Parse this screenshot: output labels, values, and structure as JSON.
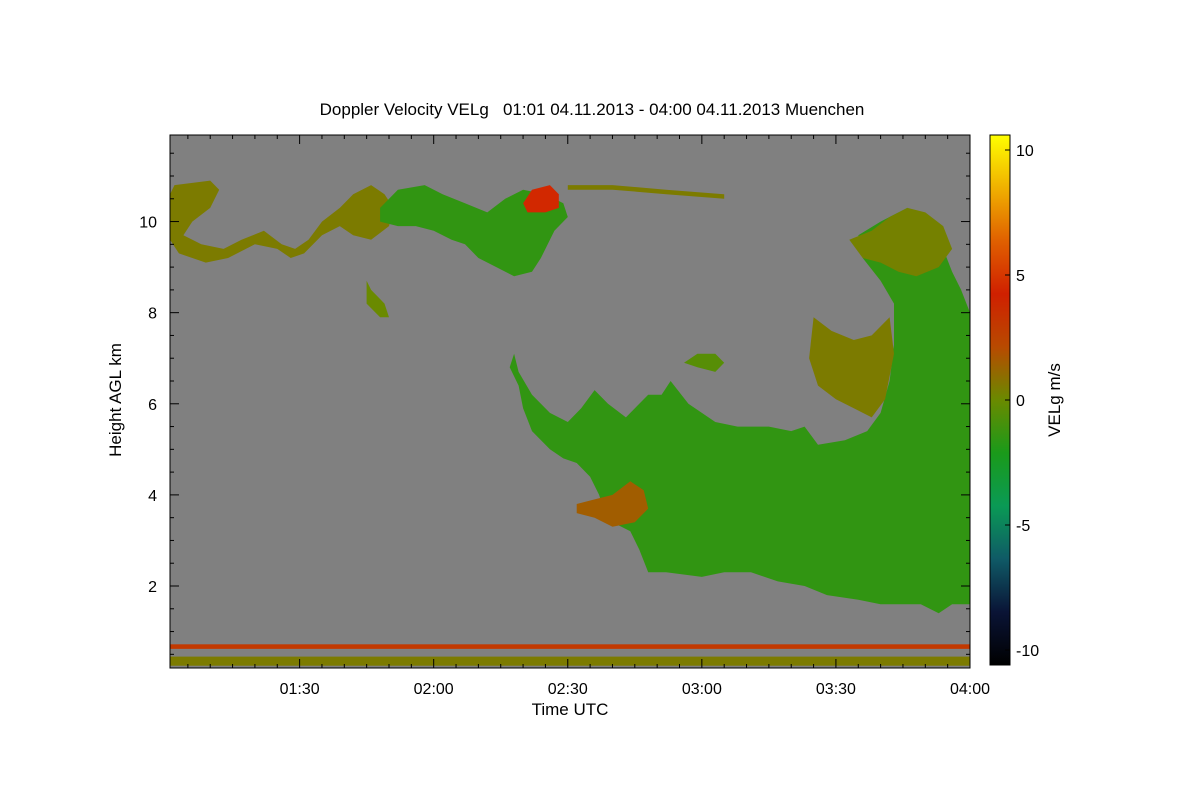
{
  "chart_data": {
    "type": "heatmap",
    "title": "Doppler Velocity VELg   01:01 04.11.2013 - 04:00 04.11.2013 Muenchen",
    "xlabel": "Time UTC",
    "ylabel": "Height AGL km",
    "x_tick_labels": [
      "01:30",
      "02:00",
      "02:30",
      "03:00",
      "03:30",
      "04:00"
    ],
    "x_tick_values_min": [
      90,
      120,
      150,
      180,
      210,
      240
    ],
    "xlim_min": [
      61,
      240
    ],
    "y_ticks": [
      2,
      4,
      6,
      8,
      10
    ],
    "ylim": [
      0.2,
      11.9
    ],
    "colorbar": {
      "label": "VELg m/s",
      "ticks": [
        10,
        5,
        0,
        -5,
        -10
      ],
      "range": [
        -10.6,
        10.6
      ],
      "colors": [
        "#000000",
        "#0a1436",
        "#0f5a66",
        "#0a9a55",
        "#1a9a1a",
        "#6a8a00",
        "#b84a00",
        "#d02000",
        "#e06000",
        "#f0b000",
        "#ffff00"
      ]
    },
    "background_color": "#808080",
    "echo_regions": [
      {
        "name": "upper-cloud-band-west",
        "mean_velocity": 0.5,
        "poly": [
          [
            61,
            10.6
          ],
          [
            62,
            10.8
          ],
          [
            70,
            10.9
          ],
          [
            72,
            10.7
          ],
          [
            70,
            10.3
          ],
          [
            66,
            10.0
          ],
          [
            64,
            9.7
          ],
          [
            68,
            9.5
          ],
          [
            73,
            9.4
          ],
          [
            77,
            9.6
          ],
          [
            82,
            9.8
          ],
          [
            86,
            9.5
          ],
          [
            89,
            9.4
          ],
          [
            92,
            9.6
          ],
          [
            95,
            10.0
          ],
          [
            99,
            10.3
          ],
          [
            102,
            10.6
          ],
          [
            106,
            10.8
          ],
          [
            109,
            10.6
          ],
          [
            111,
            10.3
          ],
          [
            110,
            9.9
          ],
          [
            106,
            9.6
          ],
          [
            102,
            9.7
          ],
          [
            99,
            9.9
          ],
          [
            95,
            9.7
          ],
          [
            91,
            9.3
          ],
          [
            88,
            9.2
          ],
          [
            85,
            9.4
          ],
          [
            80,
            9.5
          ],
          [
            74,
            9.2
          ],
          [
            69,
            9.1
          ],
          [
            63,
            9.3
          ],
          [
            61,
            9.6
          ]
        ]
      },
      {
        "name": "upper-cloud-band-center",
        "mean_velocity": -1.5,
        "poly": [
          [
            108,
            10.3
          ],
          [
            112,
            10.7
          ],
          [
            118,
            10.8
          ],
          [
            122,
            10.6
          ],
          [
            127,
            10.4
          ],
          [
            132,
            10.2
          ],
          [
            136,
            10.5
          ],
          [
            140,
            10.7
          ],
          [
            145,
            10.6
          ],
          [
            149,
            10.4
          ],
          [
            150,
            10.1
          ],
          [
            147,
            9.8
          ],
          [
            144,
            9.2
          ],
          [
            142,
            8.9
          ],
          [
            138,
            8.8
          ],
          [
            134,
            9.0
          ],
          [
            130,
            9.2
          ],
          [
            127,
            9.5
          ],
          [
            124,
            9.6
          ],
          [
            120,
            9.8
          ],
          [
            116,
            9.9
          ],
          [
            112,
            9.9
          ],
          [
            108,
            10.0
          ]
        ]
      },
      {
        "name": "warm-blob-top",
        "mean_velocity": 4.5,
        "poly": [
          [
            140,
            10.4
          ],
          [
            142,
            10.7
          ],
          [
            146,
            10.8
          ],
          [
            148,
            10.6
          ],
          [
            148,
            10.3
          ],
          [
            145,
            10.2
          ],
          [
            141,
            10.2
          ]
        ]
      },
      {
        "name": "small-cell-8km",
        "mean_velocity": 0.0,
        "poly": [
          [
            105,
            8.7
          ],
          [
            106,
            8.5
          ],
          [
            109,
            8.2
          ],
          [
            110,
            7.9
          ],
          [
            108,
            7.9
          ],
          [
            105,
            8.2
          ]
        ]
      },
      {
        "name": "thin-filament-10.8km",
        "mean_velocity": 0.5,
        "poly": [
          [
            150,
            10.8
          ],
          [
            160,
            10.8
          ],
          [
            172,
            10.7
          ],
          [
            185,
            10.6
          ],
          [
            185,
            10.5
          ],
          [
            172,
            10.6
          ],
          [
            160,
            10.7
          ],
          [
            150,
            10.7
          ]
        ]
      },
      {
        "name": "main-precip-body",
        "mean_velocity": -1.5,
        "poly": [
          [
            138,
            7.1
          ],
          [
            139,
            6.7
          ],
          [
            142,
            6.2
          ],
          [
            146,
            5.8
          ],
          [
            150,
            5.6
          ],
          [
            153,
            5.9
          ],
          [
            156,
            6.3
          ],
          [
            159,
            6.0
          ],
          [
            163,
            5.7
          ],
          [
            166,
            6.0
          ],
          [
            168,
            6.2
          ],
          [
            171,
            6.2
          ],
          [
            173,
            6.5
          ],
          [
            177,
            6.0
          ],
          [
            183,
            5.6
          ],
          [
            188,
            5.5
          ],
          [
            195,
            5.5
          ],
          [
            200,
            5.4
          ],
          [
            203,
            5.5
          ],
          [
            206,
            5.1
          ],
          [
            212,
            5.2
          ],
          [
            217,
            5.4
          ],
          [
            220,
            5.8
          ],
          [
            222,
            6.5
          ],
          [
            223,
            7.3
          ],
          [
            223,
            8.2
          ],
          [
            220,
            8.7
          ],
          [
            216,
            9.2
          ],
          [
            215,
            9.7
          ],
          [
            220,
            10.0
          ],
          [
            226,
            10.3
          ],
          [
            231,
            10.0
          ],
          [
            234,
            9.4
          ],
          [
            236,
            8.9
          ],
          [
            238,
            8.5
          ],
          [
            240,
            8.0
          ],
          [
            240,
            1.6
          ],
          [
            236,
            1.6
          ],
          [
            233,
            1.4
          ],
          [
            229,
            1.6
          ],
          [
            225,
            1.6
          ],
          [
            220,
            1.6
          ],
          [
            215,
            1.7
          ],
          [
            208,
            1.8
          ],
          [
            203,
            2.0
          ],
          [
            197,
            2.1
          ],
          [
            191,
            2.3
          ],
          [
            185,
            2.3
          ],
          [
            180,
            2.2
          ],
          [
            172,
            2.3
          ],
          [
            168,
            2.3
          ],
          [
            166,
            2.8
          ],
          [
            164,
            3.2
          ],
          [
            160,
            3.4
          ],
          [
            158,
            3.7
          ],
          [
            157,
            4.0
          ],
          [
            155,
            4.4
          ],
          [
            152,
            4.7
          ],
          [
            149,
            4.8
          ],
          [
            146,
            5.0
          ],
          [
            142,
            5.4
          ],
          [
            140,
            5.9
          ],
          [
            139,
            6.4
          ],
          [
            137,
            6.8
          ]
        ]
      },
      {
        "name": "warm-tongue-3.7km",
        "mean_velocity": 1.5,
        "poly": [
          [
            152,
            3.8
          ],
          [
            156,
            3.9
          ],
          [
            160,
            4.0
          ],
          [
            164,
            4.3
          ],
          [
            167,
            4.1
          ],
          [
            168,
            3.7
          ],
          [
            165,
            3.4
          ],
          [
            160,
            3.3
          ],
          [
            156,
            3.5
          ],
          [
            152,
            3.6
          ]
        ]
      },
      {
        "name": "upper-right-dome",
        "mean_velocity": 0.3,
        "poly": [
          [
            213,
            9.6
          ],
          [
            218,
            9.8
          ],
          [
            222,
            10.1
          ],
          [
            226,
            10.3
          ],
          [
            230,
            10.2
          ],
          [
            234,
            9.9
          ],
          [
            236,
            9.4
          ],
          [
            233,
            9.0
          ],
          [
            228,
            8.8
          ],
          [
            224,
            8.9
          ],
          [
            220,
            9.1
          ],
          [
            216,
            9.2
          ]
        ]
      },
      {
        "name": "mid-right-lobe",
        "mean_velocity": 0.5,
        "poly": [
          [
            205,
            7.9
          ],
          [
            209,
            7.6
          ],
          [
            214,
            7.4
          ],
          [
            218,
            7.5
          ],
          [
            222,
            7.9
          ],
          [
            223,
            7.1
          ],
          [
            221,
            6.1
          ],
          [
            218,
            5.7
          ],
          [
            214,
            5.9
          ],
          [
            210,
            6.1
          ],
          [
            206,
            6.4
          ],
          [
            204,
            7.0
          ]
        ]
      },
      {
        "name": "small-cell-7km",
        "mean_velocity": -0.5,
        "poly": [
          [
            176,
            6.9
          ],
          [
            179,
            7.1
          ],
          [
            183,
            7.1
          ],
          [
            185,
            6.9
          ],
          [
            183,
            6.7
          ],
          [
            179,
            6.8
          ]
        ]
      }
    ],
    "low_bands": [
      {
        "name": "red-band-0.7km",
        "height_km": [
          0.62,
          0.72
        ],
        "mean_velocity": 3.0
      },
      {
        "name": "mixed-band-0.35km",
        "height_km": [
          0.25,
          0.45
        ],
        "mean_velocity": 0.5
      }
    ]
  }
}
